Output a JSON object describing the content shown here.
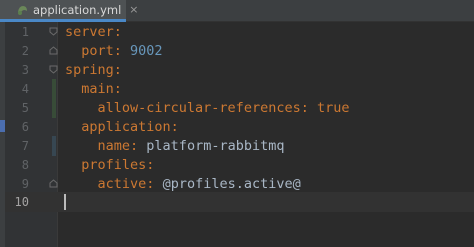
{
  "tab": {
    "filename": "application.yml",
    "close_glyph": "×"
  },
  "gutter": {
    "line_numbers": [
      "1",
      "2",
      "3",
      "4",
      "5",
      "6",
      "7",
      "8",
      "9",
      "10"
    ]
  },
  "code": {
    "l1": {
      "key": "server",
      "colon": ":"
    },
    "l2": {
      "indent": "  ",
      "key": "port",
      "colon": ":",
      "value": " 9002"
    },
    "l3": {
      "key": "spring",
      "colon": ":"
    },
    "l4": {
      "indent": "  ",
      "key": "main",
      "colon": ":"
    },
    "l5": {
      "indent": "    ",
      "key": "allow-circular-references",
      "colon": ":",
      "value": " true"
    },
    "l6": {
      "indent": "  ",
      "key": "application",
      "colon": ":"
    },
    "l7": {
      "indent": "    ",
      "key": "name",
      "colon": ":",
      "value": " platform-rabbitmq"
    },
    "l8": {
      "indent": "  ",
      "key": "profiles",
      "colon": ":"
    },
    "l9": {
      "indent": "    ",
      "key": "active",
      "colon": ":",
      "value": " @profiles.active@"
    }
  },
  "colors": {
    "background": "#2b2b2b",
    "keyword": "#cc7832",
    "number": "#6897bb",
    "text": "#a9b7c6",
    "tab_underline": "#4a88c7",
    "vcs_added": "#384c38",
    "vcs_modified": "#374752"
  },
  "icons": {
    "file_type": "yaml-icon",
    "fold": "fold-marker-icon"
  }
}
